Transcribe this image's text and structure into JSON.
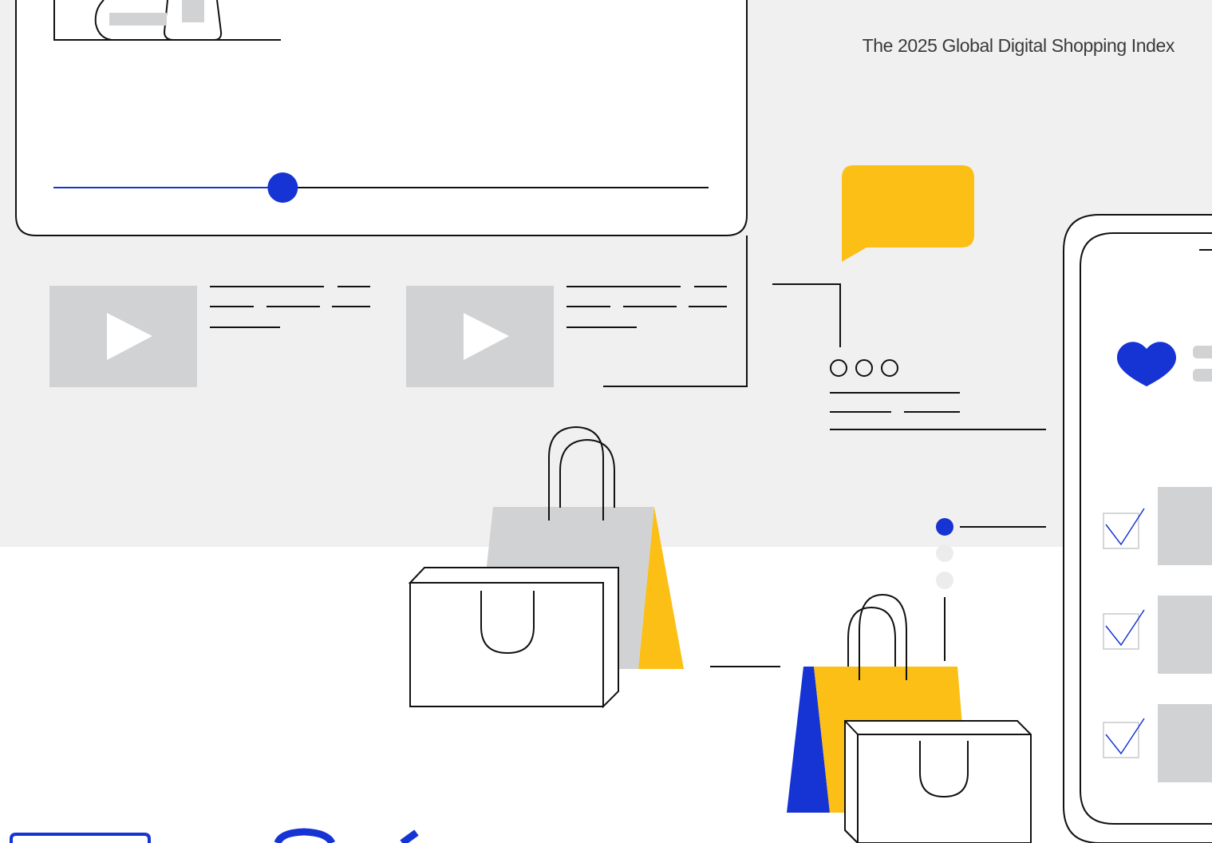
{
  "header": {
    "report_title": "The 2025 Global Digital Shopping Index"
  },
  "media_player": {
    "progress_fraction": 0.35
  },
  "video_list": {
    "item_count": 2,
    "play_icon": "play-triangle-icon"
  },
  "chat": {
    "icon": "speech-bubble-icon"
  },
  "phone": {
    "favorite_icon": "heart-icon",
    "checklist_icon": "checkmark-icon",
    "checked_items": 3
  },
  "pager": {
    "page_count": 3,
    "active_page": 1
  },
  "colors": {
    "accent_blue": "#1633d4",
    "accent_yellow": "#fbbf16",
    "placeholder_grey": "#d1d2d4",
    "band_grey": "#f0f0f0",
    "line": "#111111"
  }
}
